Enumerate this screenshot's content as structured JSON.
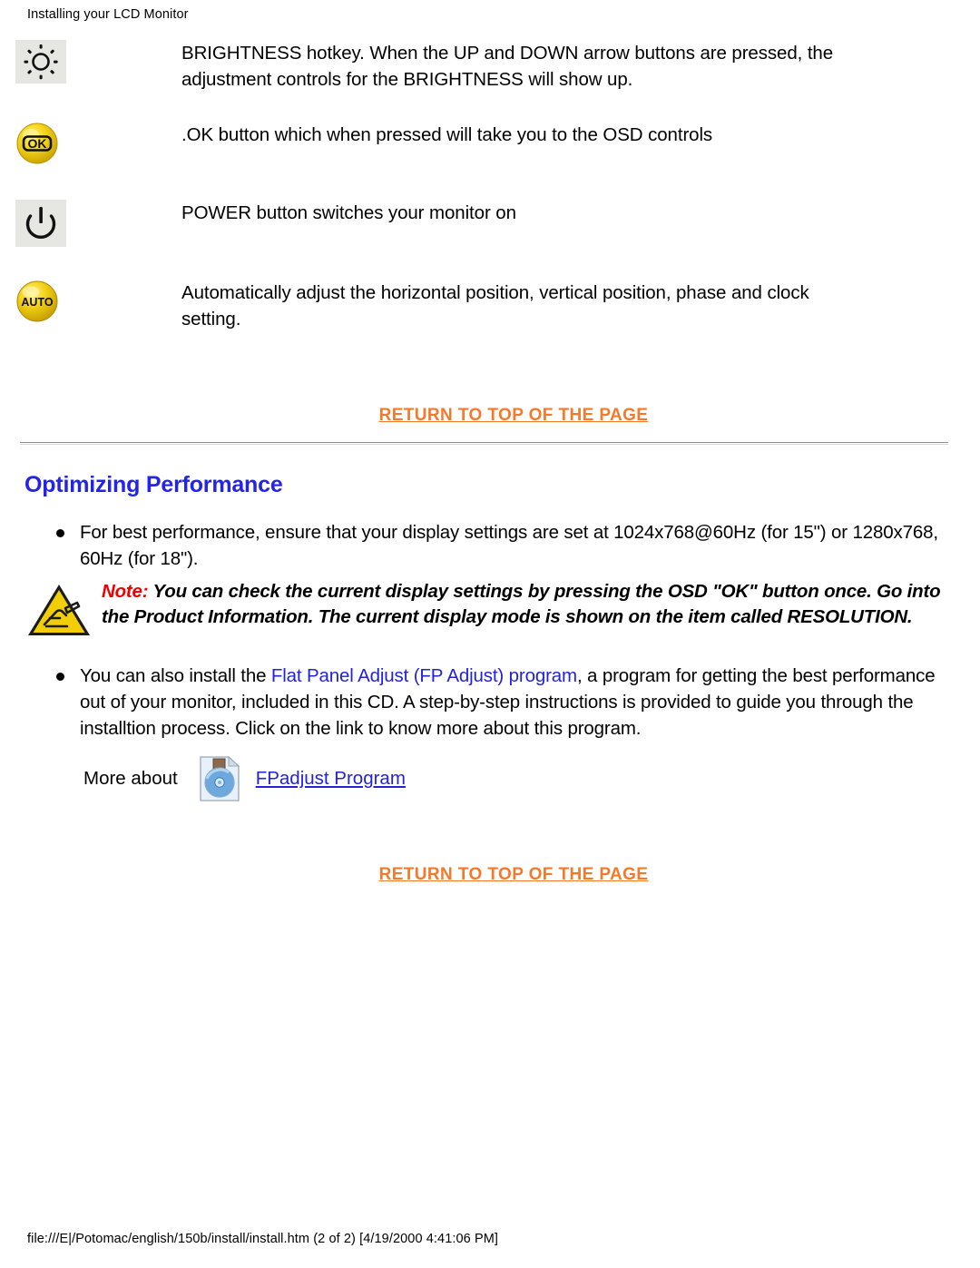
{
  "header": {
    "title": "Installing your LCD Monitor"
  },
  "controls": [
    {
      "icon": "brightness-icon",
      "description": "BRIGHTNESS hotkey. When the UP and DOWN arrow buttons are pressed, the adjustment controls for the BRIGHTNESS will show up."
    },
    {
      "icon": "ok-button-icon",
      "description": ".OK button which when pressed will take you to the OSD controls"
    },
    {
      "icon": "power-icon",
      "description": "POWER button switches your monitor on"
    },
    {
      "icon": "auto-button-icon",
      "description": "Automatically adjust the horizontal position, vertical position, phase and clock setting."
    }
  ],
  "return_link_top": {
    "label": "RETURN TO TOP OF THE PAGE"
  },
  "return_link_bottom": {
    "label": "RETURN TO TOP OF THE PAGE"
  },
  "section": {
    "heading": "Optimizing Performance",
    "bullet1": "For best performance, ensure that your display settings are set at 1024x768@60Hz (for 15\") or 1280x768, 60Hz (for 18\").",
    "note": {
      "label": "Note:",
      "body": "You can check the current display settings by pressing the OSD \"OK\" button once. Go into the Product Information. The current display mode is shown on the item called RESOLUTION."
    },
    "bullet2_pre": "You can also install the ",
    "bullet2_link": "Flat Panel Adjust (FP Adjust) program",
    "bullet2_post": ", a program for getting the best performance out of your monitor, included in this CD. A step-by-step instructions is provided to guide you through the installtion process. Click on the link to know more about this program.",
    "more_about_label": "More about",
    "more_about_link": "FPadjust Program",
    "disk_icon": "cd-disk-icon",
    "note_icon": "warning-triangle-icon"
  },
  "footer": {
    "path": "file:///E|/Potomac/english/150b/install/install.htm (2 of 2) [4/19/2000 4:41:06 PM]"
  },
  "colors": {
    "link_orange": "#F4792B",
    "link_blue": "#2222DD",
    "heading_blue": "#2424E8",
    "note_red": "#EE0000",
    "button_yellow": "#F2D21A",
    "icon_bg_gray": "#E6E6E3"
  }
}
